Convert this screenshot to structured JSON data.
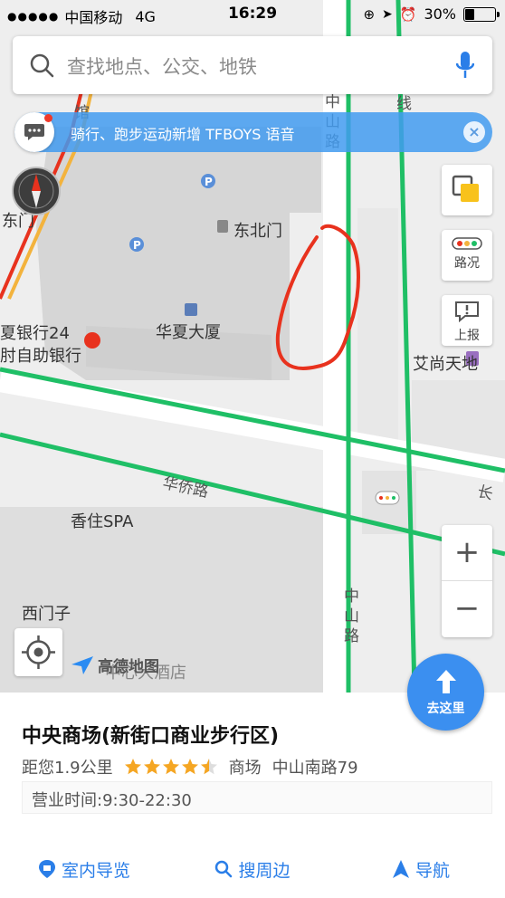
{
  "status_bar": {
    "carrier": "中国移动",
    "network": "4G",
    "time": "16:29",
    "battery": "30%"
  },
  "search": {
    "placeholder": "查找地点、公交、地铁"
  },
  "banner": {
    "text": "骑行、跑步运动新增 TFBOYS 语音"
  },
  "side_buttons": {
    "traffic": "路况",
    "report": "上报"
  },
  "map_labels": {
    "northeast_gate": "东北门",
    "huaxia_building": "华夏大厦",
    "east_gate": "东门",
    "bank": "夏银行24",
    "bank2": "肘自助银行",
    "aishang": "艾尚天地",
    "xiangzhu_spa": "香住SPA",
    "ximenzi": "西门子",
    "hotel": "中心大酒店",
    "zhongshan_rd_top": "中山路",
    "zhongshan_rd_bottom": "中山路",
    "huaqiao_rd": "华侨路",
    "chang": "长",
    "line": "线",
    "hotel_short": "馆"
  },
  "brand": "高德地图",
  "goto_button": "去这里",
  "place": {
    "name": "中央商场(新街口商业步行区)",
    "distance": "距您1.9公里",
    "rating": 4.5,
    "category": "商场",
    "address": "中山南路79",
    "hours": "营业时间:9:30-22:30"
  },
  "actions": {
    "indoor": "室内导览",
    "nearby": "搜周边",
    "navigate": "导航"
  },
  "colors": {
    "accent": "#2a7ee8",
    "road_green": "#1fbf66",
    "annotation_red": "#e8321e",
    "star": "#f5a623"
  }
}
